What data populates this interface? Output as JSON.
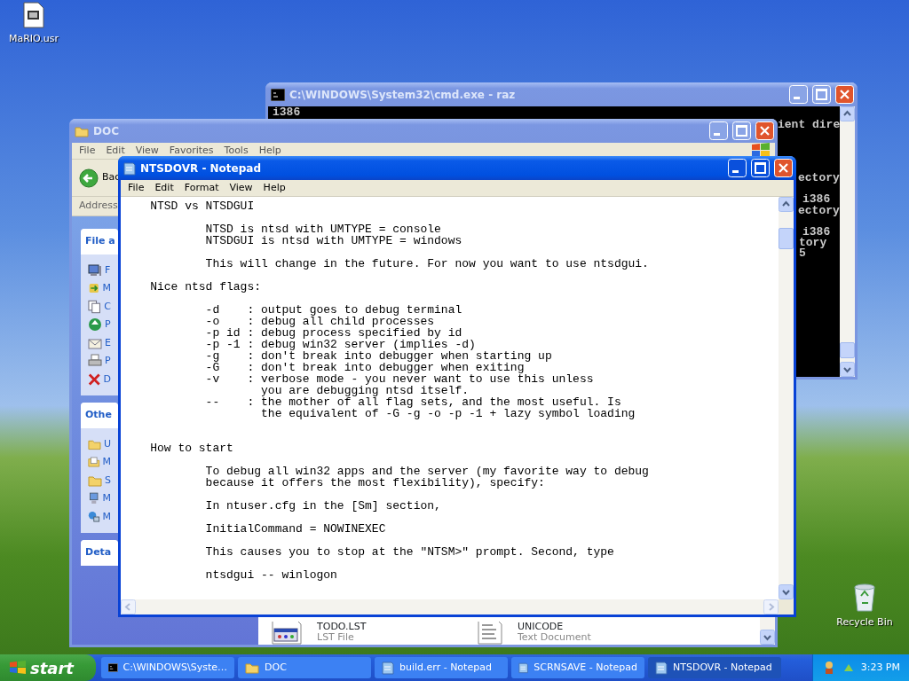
{
  "desktop_icons": [
    {
      "kind": "file",
      "label": "MaRIO.usr"
    },
    {
      "kind": "bin",
      "label": "Recycle Bin"
    }
  ],
  "cmd_window": {
    "title": "C:\\WINDOWS\\System32\\cmd.exe - raz",
    "active": false,
    "fragments": [
      "i386",
      "ient dire",
      "ectory",
      "i386",
      "ectory",
      "i386",
      "tory",
      "5"
    ]
  },
  "explorer_window": {
    "title": "DOC",
    "active": false,
    "menu": [
      "File",
      "Edit",
      "View",
      "Favorites",
      "Tools",
      "Help"
    ],
    "back_label": "Bac",
    "address_label": "Address",
    "panes": [
      {
        "title": "File a",
        "items": [
          {
            "kind": "monitor",
            "label": "F"
          },
          {
            "kind": "arrows",
            "label": "M"
          },
          {
            "kind": "pages",
            "label": "C"
          },
          {
            "kind": "globe",
            "label": "P"
          },
          {
            "kind": "envelope",
            "label": "E"
          },
          {
            "kind": "printer",
            "label": "P"
          },
          {
            "kind": "cross",
            "label": "D"
          }
        ]
      },
      {
        "title": "Othe",
        "items": [
          {
            "kind": "folder",
            "label": "U"
          },
          {
            "kind": "docfolder",
            "label": "M"
          },
          {
            "kind": "folder",
            "label": "S"
          },
          {
            "kind": "computer",
            "label": "M"
          },
          {
            "kind": "network",
            "label": "M"
          }
        ]
      },
      {
        "title": "Deta"
      }
    ],
    "files": [
      {
        "kind": "app",
        "name": "TODO.LST",
        "type": "LST File"
      },
      {
        "kind": "text",
        "name": "UNICODE",
        "type": "Text Document"
      }
    ]
  },
  "notepad_window": {
    "title": "NTSDOVR - Notepad",
    "active": true,
    "menu": [
      "File",
      "Edit",
      "Format",
      "View",
      "Help"
    ],
    "text": "    NTSD vs NTSDGUI\n\n            NTSD is ntsd with UMTYPE = console\n            NTSDGUI is ntsd with UMTYPE = windows\n\n            This will change in the future. For now you want to use ntsdgui.\n\n    Nice ntsd flags:\n\n            -d    : output goes to debug terminal\n            -o    : debug all child processes\n            -p id : debug process specified by id\n            -p -1 : debug win32 server (implies -d)\n            -g    : don't break into debugger when starting up\n            -G    : don't break into debugger when exiting\n            -v    : verbose mode - you never want to use this unless\n                    you are debugging ntsd itself.\n            --    : the mother of all flag sets, and the most useful. Is\n                    the equivalent of -G -g -o -p -1 + lazy symbol loading\n\n\n    How to start\n\n            To debug all win32 apps and the server (my favorite way to debug\n            because it offers the most flexibility), specify:\n\n            In ntuser.cfg in the [Sm] section,\n\n            InitialCommand = NOWINEXEC\n\n            This causes you to stop at the \"NTSM>\" prompt. Second, type\n\n            ntsdgui -- winlogon"
  },
  "taskbar": {
    "start_label": "start",
    "tasks": [
      {
        "kind": "cmd",
        "label": "C:\\WINDOWS\\Syste…",
        "selected": false
      },
      {
        "kind": "folder",
        "label": "DOC",
        "selected": false
      },
      {
        "kind": "notepad",
        "label": "build.err - Notepad",
        "selected": false
      },
      {
        "kind": "notepad",
        "label": "SCRNSAVE - Notepad",
        "selected": false
      },
      {
        "kind": "notepad",
        "label": "NTSDOVR - Notepad",
        "selected": true
      }
    ],
    "clock": "3:23 PM"
  }
}
